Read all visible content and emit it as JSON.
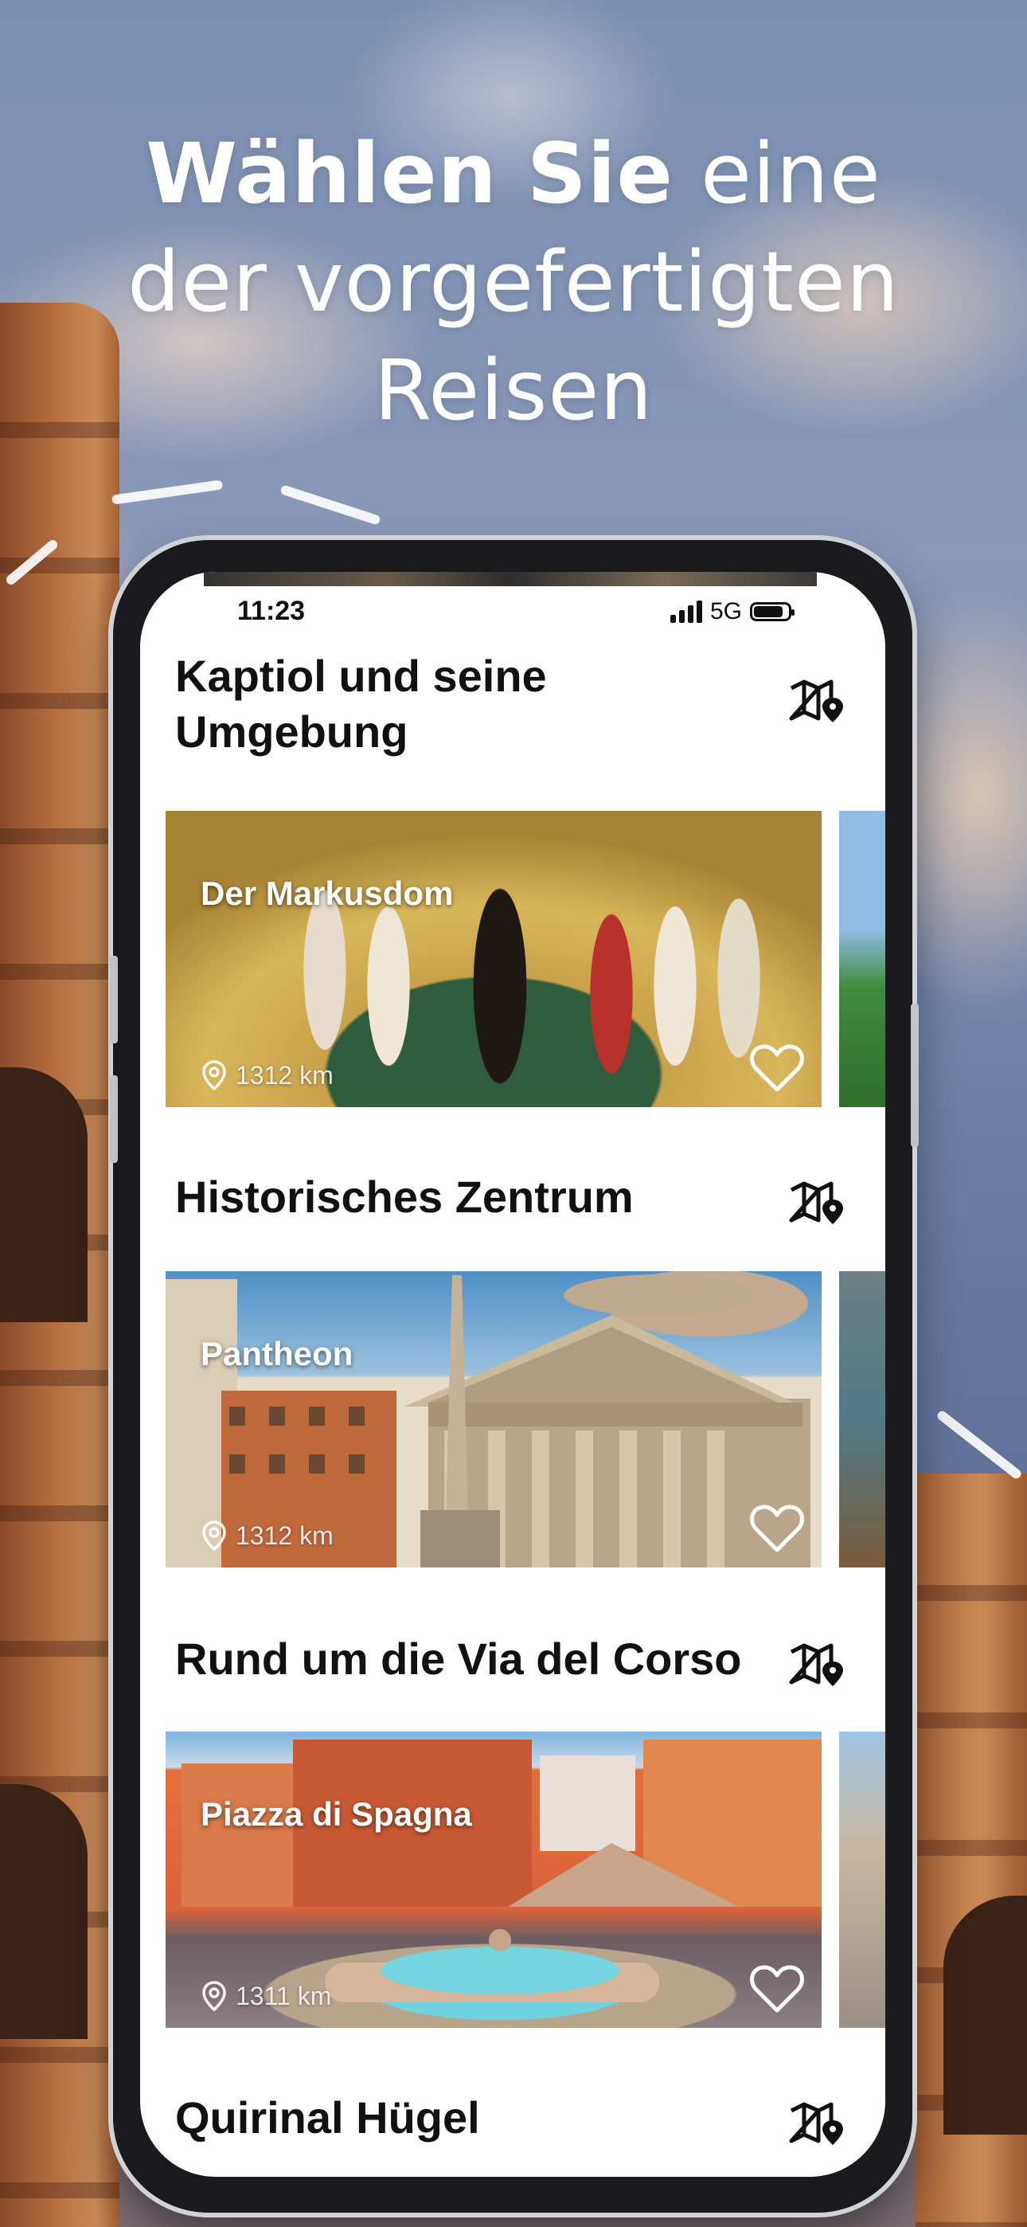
{
  "headline": {
    "bold": "Wählen Sie",
    "rest_line1": " eine",
    "line2": "der vorgefertigten",
    "line3": "Reisen"
  },
  "status_bar": {
    "time": "11:23",
    "network": "5G"
  },
  "sections": [
    {
      "title": "Kaptiol und seine Umgebung",
      "map_icon": "map-pin-icon",
      "card": {
        "name": "Der Markusdom",
        "distance": "1312 km"
      }
    },
    {
      "title": "Historisches Zentrum",
      "map_icon": "map-pin-icon",
      "card": {
        "name": "Pantheon",
        "distance": "1312 km"
      }
    },
    {
      "title": "Rund um die Via del Corso",
      "map_icon": "map-pin-icon",
      "card": {
        "name": "Piazza di Spagna",
        "distance": "1311 km"
      }
    },
    {
      "title": "Quirinal Hügel",
      "map_icon": "map-pin-icon"
    }
  ],
  "icons": {
    "distance": "location-pin-icon",
    "favorite": "heart-outline-icon"
  },
  "colors": {
    "headline_text": "#ffffff",
    "title_text": "#111111",
    "screen_bg": "#ffffff"
  }
}
